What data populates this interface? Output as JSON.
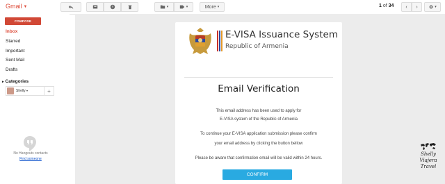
{
  "app": {
    "logo_text": "Gmail"
  },
  "toolbar": {
    "reply_icon": "reply-icon",
    "archive_icon": "archive-icon",
    "spam_icon": "report-spam-icon",
    "delete_icon": "delete-icon",
    "folder_icon": "folder-icon",
    "label_icon": "label-icon",
    "more_label": "More",
    "pager_prefix": "1",
    "pager_of": "of",
    "pager_total": "34",
    "settings_icon": "gear-icon"
  },
  "sidebar": {
    "compose_label": "COMPOSE",
    "items": [
      {
        "label": "Inbox",
        "active": true
      },
      {
        "label": "Starred"
      },
      {
        "label": "Important"
      },
      {
        "label": "Sent Mail"
      },
      {
        "label": "Drafts"
      }
    ],
    "categories_label": "Categories",
    "hangouts_user": "Shelly",
    "hangouts_empty": "No Hangouts contacts",
    "find_someone": "Find someone"
  },
  "email": {
    "system_title": "E-VISA Issuance System",
    "system_subtitle": "Republic of Armenia",
    "heading": "Email Verification",
    "p1_line1": "This email address has been used to apply for",
    "p1_line2": "E-VISA system of the Republic of Armenia",
    "p2_line1": "To continue your E-VISA application submission please confirm",
    "p2_line2": "your email address by clicking the button bellow",
    "p3": "Please be aware that confirmation email will be valid within 24 hours.",
    "confirm_label": "CONFIRM",
    "accent_color": "#29aae1"
  },
  "watermark": {
    "line1": "Shelly",
    "line2": "Viajera",
    "line3": "Travel"
  }
}
